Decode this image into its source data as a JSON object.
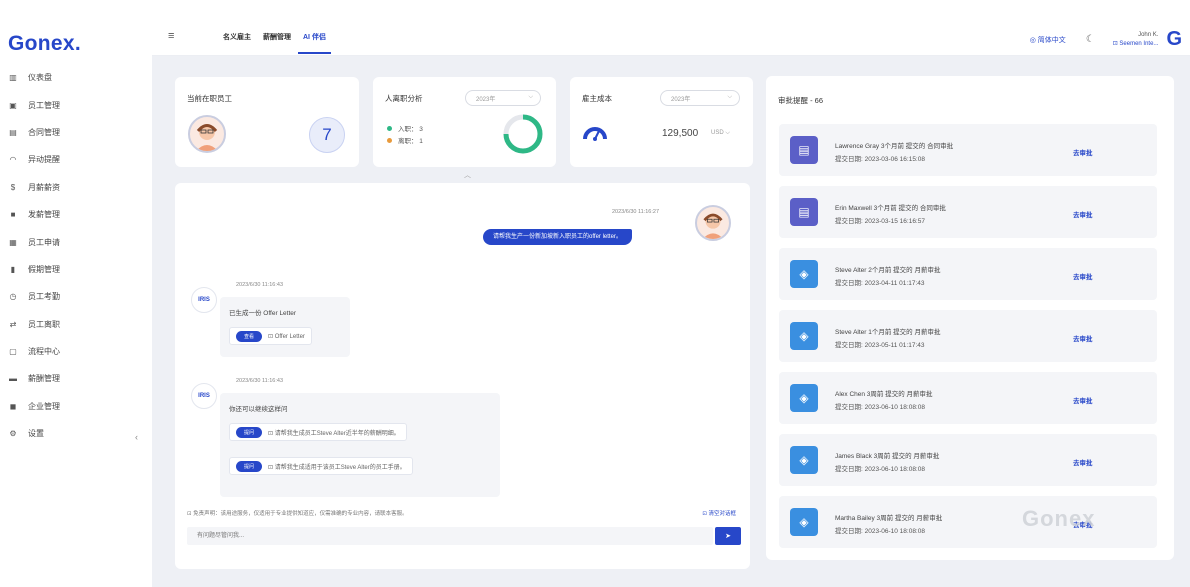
{
  "brand": {
    "logo": "Gonex."
  },
  "sidebar": {
    "items": [
      {
        "label": "仪表盘",
        "icon": "dashboard-icon"
      },
      {
        "label": "员工管理",
        "icon": "employee-icon"
      },
      {
        "label": "合同管理",
        "icon": "contract-icon"
      },
      {
        "label": "异动提醒",
        "icon": "bell-icon"
      },
      {
        "label": "月薪薪资",
        "icon": "dollar-icon"
      },
      {
        "label": "发薪管理",
        "icon": "payout-icon"
      },
      {
        "label": "员工申请",
        "icon": "application-icon"
      },
      {
        "label": "假期管理",
        "icon": "leave-icon"
      },
      {
        "label": "员工考勤",
        "icon": "attendance-icon"
      },
      {
        "label": "员工离职",
        "icon": "resign-icon"
      },
      {
        "label": "流程中心",
        "icon": "calendar-icon"
      },
      {
        "label": "薪酬管理",
        "icon": "payroll-icon"
      },
      {
        "label": "企业管理",
        "icon": "company-icon"
      },
      {
        "label": "设置",
        "icon": "gear-icon"
      }
    ],
    "collapse": "‹"
  },
  "topbar": {
    "tabs": [
      {
        "label": "名义雇主"
      },
      {
        "label": "薪酬管理"
      },
      {
        "label": "AI 伴侣"
      }
    ],
    "language": "◎ 简体中文",
    "user_name": "John K.",
    "user_company": "⊡ Seemen Inte...",
    "g_logo": "G"
  },
  "stats": {
    "employees": {
      "title": "当前在职员工",
      "count": "7"
    },
    "flow": {
      "title": "人离职分析",
      "select": "2023年",
      "legend": [
        {
          "label": "入职：  3",
          "color": "#2eb886"
        },
        {
          "label": "离职：  1",
          "color": "#e89a3c"
        }
      ]
    },
    "cost": {
      "title": "雇主成本",
      "select": "2023年",
      "value": "129,500",
      "unit": "USD ⌵"
    }
  },
  "chat": {
    "user_msg_time": "2023/6/30 11:16:27",
    "user_msg": "请帮我生产一份新加坡新入职员工的offer letter。",
    "bot_name": "IRIS",
    "bot1": {
      "time": "2023/6/30 11:16:43",
      "text": "已生成一份 Offer Letter",
      "chip_btn": "查看",
      "chip_text": "⊡ Offer Letter"
    },
    "bot2": {
      "time": "2023/6/30 11:16:43",
      "text": "你还可以继续这样问",
      "suggestions": [
        {
          "btn": "提问",
          "text": "⊡ 请帮我生成员工Steve Alter近半年的薪酬明细。"
        },
        {
          "btn": "提问",
          "text": "⊡ 请帮我生成适用于该员工Steve Alter的员工手册。"
        }
      ]
    },
    "disclaimer": "⊡ 免责声明：该用途服务，仅适用于专业提供知道应，仅需准确的专业内容，请联本客服。",
    "clear": "⊡ 清空对话框",
    "input_placeholder": "有问题尽管问我...",
    "send_icon": "➤"
  },
  "approvals": {
    "title": "审批提醒 - 66",
    "link_label": "去审批",
    "items": [
      {
        "line1": "Lawrence Gray 3个月前 提交的 合同审批",
        "line2": "提交日期: 2023-03-06 16:15:08",
        "icon": "id-card-icon",
        "color": "#5b5fc7"
      },
      {
        "line1": "Erin Maxwell 3个月前 提交的 合同审批",
        "line2": "提交日期: 2023-03-15 16:16:57",
        "icon": "id-card-icon",
        "color": "#5b5fc7"
      },
      {
        "line1": "Steve Alter 2个月前 提交的 月薪审批",
        "line2": "提交日期: 2023-04-11 01:17:43",
        "icon": "diamond-icon",
        "color": "#3a8fe0"
      },
      {
        "line1": "Steve Alter 1个月前 提交的 月薪审批",
        "line2": "提交日期: 2023-05-11 01:17:43",
        "icon": "diamond-icon",
        "color": "#3a8fe0"
      },
      {
        "line1": "Alex Chen 3周前 提交的 月薪审批",
        "line2": "提交日期: 2023-06-10 18:08:08",
        "icon": "diamond-icon",
        "color": "#3a8fe0"
      },
      {
        "line1": "James Black 3周前 提交的 月薪审批",
        "line2": "提交日期: 2023-06-10 18:08:08",
        "icon": "diamond-icon",
        "color": "#3a8fe0"
      },
      {
        "line1": "Martha Bailey 3周前 提交的 月薪审批",
        "line2": "提交日期: 2023-06-10 18:08:08",
        "icon": "diamond-icon",
        "color": "#3a8fe0"
      }
    ]
  },
  "watermark": "Gonex"
}
